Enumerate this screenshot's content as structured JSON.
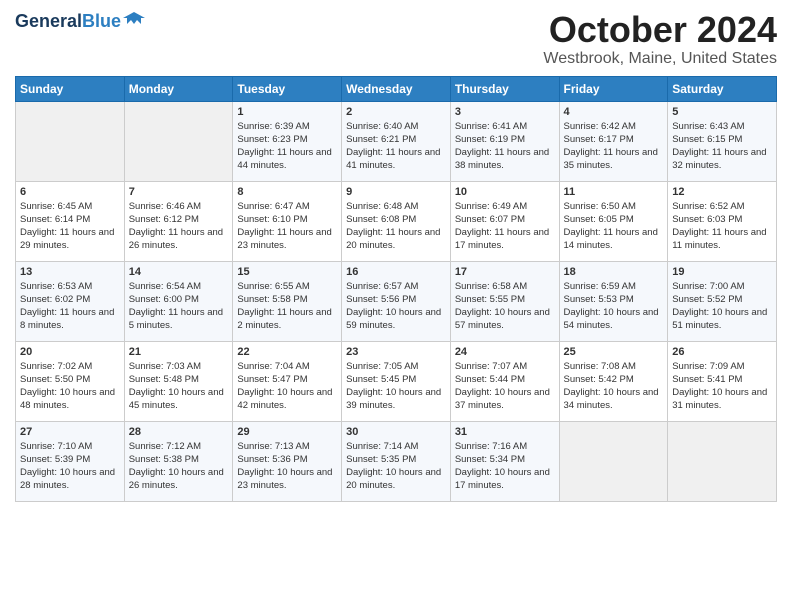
{
  "header": {
    "logo_general": "General",
    "logo_blue": "Blue",
    "title": "October 2024",
    "subtitle": "Westbrook, Maine, United States"
  },
  "weekdays": [
    "Sunday",
    "Monday",
    "Tuesday",
    "Wednesday",
    "Thursday",
    "Friday",
    "Saturday"
  ],
  "weeks": [
    [
      {
        "day": "",
        "sunrise": "",
        "sunset": "",
        "daylight": "",
        "empty": true
      },
      {
        "day": "",
        "sunrise": "",
        "sunset": "",
        "daylight": "",
        "empty": true
      },
      {
        "day": "1",
        "sunrise": "Sunrise: 6:39 AM",
        "sunset": "Sunset: 6:23 PM",
        "daylight": "Daylight: 11 hours and 44 minutes."
      },
      {
        "day": "2",
        "sunrise": "Sunrise: 6:40 AM",
        "sunset": "Sunset: 6:21 PM",
        "daylight": "Daylight: 11 hours and 41 minutes."
      },
      {
        "day": "3",
        "sunrise": "Sunrise: 6:41 AM",
        "sunset": "Sunset: 6:19 PM",
        "daylight": "Daylight: 11 hours and 38 minutes."
      },
      {
        "day": "4",
        "sunrise": "Sunrise: 6:42 AM",
        "sunset": "Sunset: 6:17 PM",
        "daylight": "Daylight: 11 hours and 35 minutes."
      },
      {
        "day": "5",
        "sunrise": "Sunrise: 6:43 AM",
        "sunset": "Sunset: 6:15 PM",
        "daylight": "Daylight: 11 hours and 32 minutes."
      }
    ],
    [
      {
        "day": "6",
        "sunrise": "Sunrise: 6:45 AM",
        "sunset": "Sunset: 6:14 PM",
        "daylight": "Daylight: 11 hours and 29 minutes."
      },
      {
        "day": "7",
        "sunrise": "Sunrise: 6:46 AM",
        "sunset": "Sunset: 6:12 PM",
        "daylight": "Daylight: 11 hours and 26 minutes."
      },
      {
        "day": "8",
        "sunrise": "Sunrise: 6:47 AM",
        "sunset": "Sunset: 6:10 PM",
        "daylight": "Daylight: 11 hours and 23 minutes."
      },
      {
        "day": "9",
        "sunrise": "Sunrise: 6:48 AM",
        "sunset": "Sunset: 6:08 PM",
        "daylight": "Daylight: 11 hours and 20 minutes."
      },
      {
        "day": "10",
        "sunrise": "Sunrise: 6:49 AM",
        "sunset": "Sunset: 6:07 PM",
        "daylight": "Daylight: 11 hours and 17 minutes."
      },
      {
        "day": "11",
        "sunrise": "Sunrise: 6:50 AM",
        "sunset": "Sunset: 6:05 PM",
        "daylight": "Daylight: 11 hours and 14 minutes."
      },
      {
        "day": "12",
        "sunrise": "Sunrise: 6:52 AM",
        "sunset": "Sunset: 6:03 PM",
        "daylight": "Daylight: 11 hours and 11 minutes."
      }
    ],
    [
      {
        "day": "13",
        "sunrise": "Sunrise: 6:53 AM",
        "sunset": "Sunset: 6:02 PM",
        "daylight": "Daylight: 11 hours and 8 minutes."
      },
      {
        "day": "14",
        "sunrise": "Sunrise: 6:54 AM",
        "sunset": "Sunset: 6:00 PM",
        "daylight": "Daylight: 11 hours and 5 minutes."
      },
      {
        "day": "15",
        "sunrise": "Sunrise: 6:55 AM",
        "sunset": "Sunset: 5:58 PM",
        "daylight": "Daylight: 11 hours and 2 minutes."
      },
      {
        "day": "16",
        "sunrise": "Sunrise: 6:57 AM",
        "sunset": "Sunset: 5:56 PM",
        "daylight": "Daylight: 10 hours and 59 minutes."
      },
      {
        "day": "17",
        "sunrise": "Sunrise: 6:58 AM",
        "sunset": "Sunset: 5:55 PM",
        "daylight": "Daylight: 10 hours and 57 minutes."
      },
      {
        "day": "18",
        "sunrise": "Sunrise: 6:59 AM",
        "sunset": "Sunset: 5:53 PM",
        "daylight": "Daylight: 10 hours and 54 minutes."
      },
      {
        "day": "19",
        "sunrise": "Sunrise: 7:00 AM",
        "sunset": "Sunset: 5:52 PM",
        "daylight": "Daylight: 10 hours and 51 minutes."
      }
    ],
    [
      {
        "day": "20",
        "sunrise": "Sunrise: 7:02 AM",
        "sunset": "Sunset: 5:50 PM",
        "daylight": "Daylight: 10 hours and 48 minutes."
      },
      {
        "day": "21",
        "sunrise": "Sunrise: 7:03 AM",
        "sunset": "Sunset: 5:48 PM",
        "daylight": "Daylight: 10 hours and 45 minutes."
      },
      {
        "day": "22",
        "sunrise": "Sunrise: 7:04 AM",
        "sunset": "Sunset: 5:47 PM",
        "daylight": "Daylight: 10 hours and 42 minutes."
      },
      {
        "day": "23",
        "sunrise": "Sunrise: 7:05 AM",
        "sunset": "Sunset: 5:45 PM",
        "daylight": "Daylight: 10 hours and 39 minutes."
      },
      {
        "day": "24",
        "sunrise": "Sunrise: 7:07 AM",
        "sunset": "Sunset: 5:44 PM",
        "daylight": "Daylight: 10 hours and 37 minutes."
      },
      {
        "day": "25",
        "sunrise": "Sunrise: 7:08 AM",
        "sunset": "Sunset: 5:42 PM",
        "daylight": "Daylight: 10 hours and 34 minutes."
      },
      {
        "day": "26",
        "sunrise": "Sunrise: 7:09 AM",
        "sunset": "Sunset: 5:41 PM",
        "daylight": "Daylight: 10 hours and 31 minutes."
      }
    ],
    [
      {
        "day": "27",
        "sunrise": "Sunrise: 7:10 AM",
        "sunset": "Sunset: 5:39 PM",
        "daylight": "Daylight: 10 hours and 28 minutes."
      },
      {
        "day": "28",
        "sunrise": "Sunrise: 7:12 AM",
        "sunset": "Sunset: 5:38 PM",
        "daylight": "Daylight: 10 hours and 26 minutes."
      },
      {
        "day": "29",
        "sunrise": "Sunrise: 7:13 AM",
        "sunset": "Sunset: 5:36 PM",
        "daylight": "Daylight: 10 hours and 23 minutes."
      },
      {
        "day": "30",
        "sunrise": "Sunrise: 7:14 AM",
        "sunset": "Sunset: 5:35 PM",
        "daylight": "Daylight: 10 hours and 20 minutes."
      },
      {
        "day": "31",
        "sunrise": "Sunrise: 7:16 AM",
        "sunset": "Sunset: 5:34 PM",
        "daylight": "Daylight: 10 hours and 17 minutes."
      },
      {
        "day": "",
        "sunrise": "",
        "sunset": "",
        "daylight": "",
        "empty": true
      },
      {
        "day": "",
        "sunrise": "",
        "sunset": "",
        "daylight": "",
        "empty": true
      }
    ]
  ]
}
